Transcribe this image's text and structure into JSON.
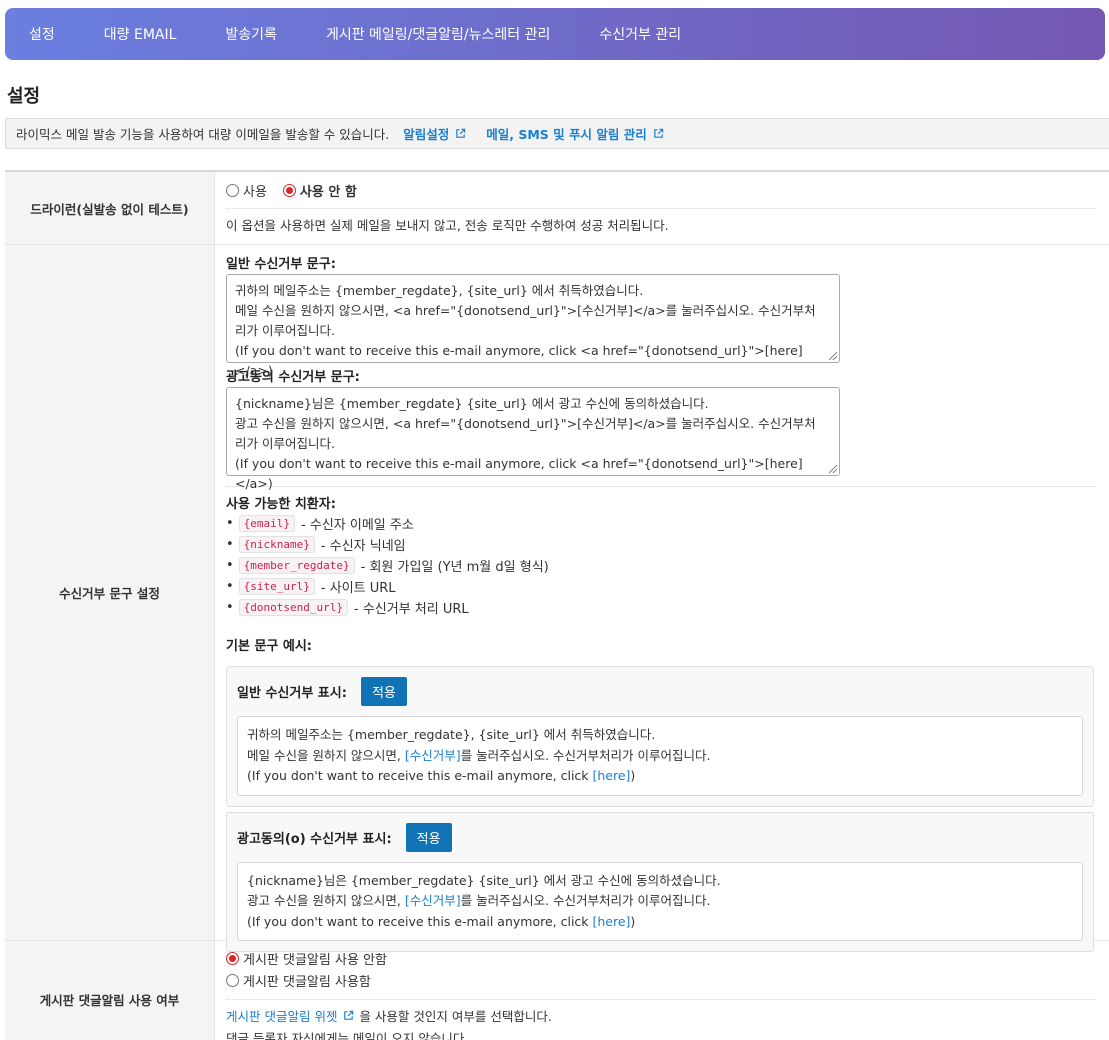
{
  "nav": {
    "items": [
      "설정",
      "대량 EMAIL",
      "발송기록",
      "게시판 메일링/댓글알림/뉴스레터 관리",
      "수신거부 관리"
    ]
  },
  "page_title": "설정",
  "info": {
    "text": "라이믹스 메일 발송 기능을 사용하여 대량 이메일을 발송할 수 있습니다.",
    "links": [
      "알림설정",
      "메일, SMS 및 푸시 알림 관리"
    ]
  },
  "dryrun": {
    "label": "드라이런(실발송 없이 테스트)",
    "option_use": "사용",
    "option_nouse": "사용 안 함",
    "selected": "nouse",
    "help": "이 옵션을 사용하면 실제 메일을 보내지 않고, 전송 로직만 수행하여 성공 처리됩니다."
  },
  "unsub": {
    "label": "수신거부 문구 설정",
    "general_label": "일반 수신거부 문구:",
    "general_lines": [
      "귀하의 메일주소는 {member_regdate}, {site_url} 에서 취득하였습니다.",
      "메일 수신을 원하지 않으시면, <a href=\"{donotsend_url}\">[수신거부]</a>를 눌러주십시오. 수신거부처",
      "리가 이루어집니다.",
      "(If you don't want to receive this e-mail anymore, click <a href=\"{donotsend_url}\">[here]</a>)"
    ],
    "ad_label": "광고동의 수신거부 문구:",
    "ad_lines": [
      "{nickname}님은 {member_regdate} {site_url} 에서 광고 수신에 동의하셨습니다.",
      "광고 수신을 원하지 않으시면, <a href=\"{donotsend_url}\">[수신거부]</a>를 눌러주십시오. 수신거부처",
      "리가 이루어집니다.",
      "(If you don't want to receive this e-mail anymore, click <a href=\"{donotsend_url}\">[here]</a>)"
    ],
    "placeholders_label": "사용 가능한 치환자:",
    "placeholders": [
      {
        "code": "{email}",
        "desc": "- 수신자 이메일 주소"
      },
      {
        "code": "{nickname}",
        "desc": "- 수신자 닉네임"
      },
      {
        "code": "{member_regdate}",
        "desc": "- 회원 가입일 (Y년 m월 d일 형식)"
      },
      {
        "code": "{site_url}",
        "desc": "- 사이트 URL"
      },
      {
        "code": "{donotsend_url}",
        "desc": "- 수신거부 처리 URL"
      }
    ],
    "examples_label": "기본 문구 예시:",
    "apply_label": "적용",
    "ex_general": {
      "title": "일반 수신거부 표시:",
      "line1": "귀하의 메일주소는 {member_regdate}, {site_url} 에서 취득하였습니다.",
      "line2_a": "메일 수신을 원하지 않으시면, ",
      "line2_link": "[수신거부]",
      "line2_b": "를 눌러주십시오. 수신거부처리가 이루어집니다.",
      "line3_a": "(If you don't want to receive this e-mail anymore, click ",
      "line3_link": "[here]",
      "line3_b": ")"
    },
    "ex_ad": {
      "title": "광고동의(o) 수신거부 표시:",
      "line1": "{nickname}님은 {member_regdate} {site_url} 에서 광고 수신에 동의하셨습니다.",
      "line2_a": "광고 수신을 원하지 않으시면, ",
      "line2_link": "[수신거부]",
      "line2_b": "를 눌러주십시오. 수신거부처리가 이루어집니다.",
      "line3_a": "(If you don't want to receive this e-mail anymore, click ",
      "line3_link": "[here]",
      "line3_b": ")"
    }
  },
  "comment_notify": {
    "label": "게시판 댓글알림 사용 여부",
    "option_off": "게시판 댓글알림 사용 안함",
    "option_on": "게시판 댓글알림 사용함",
    "selected": "off",
    "help_link": "게시판 댓글알림 위젯",
    "help_text": "을 사용할 것인지 여부를 선택합니다.",
    "help_text2": "댓글 등록자 자신에게는 메일이 오지 않습니다."
  },
  "colors": {
    "nav_start": "#6a7fe0",
    "nav_end": "#7458b2",
    "link": "#1a7fd0",
    "button": "#0f73b6",
    "radio_selected": "#d9252b",
    "code": "#c7254e"
  }
}
